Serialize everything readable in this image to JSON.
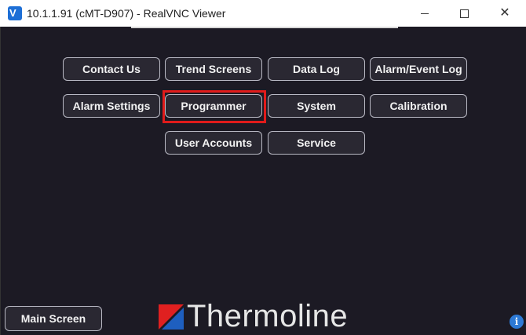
{
  "window": {
    "title": "10.1.1.91 (cMT-D907) - RealVNC Viewer",
    "minimize_glyph": "",
    "close_glyph": "✕"
  },
  "menu": {
    "row1": [
      "Contact Us",
      "Trend Screens",
      "Data Log",
      "Alarm/Event Log"
    ],
    "row2": [
      "Alarm Settings",
      "Programmer",
      "System",
      "Calibration"
    ],
    "row3": [
      "User Accounts",
      "Service"
    ]
  },
  "footer": {
    "main_screen": "Main Screen",
    "logo_text": "Thermoline",
    "info_glyph": "i"
  },
  "colors": {
    "background": "#1c1a24",
    "highlight": "#e01b1b",
    "logo_red": "#e02020",
    "logo_blue": "#1e5fbf"
  },
  "icons": [
    "realvnc-icon",
    "minimize-icon",
    "maximize-icon",
    "close-icon",
    "thermoline-logo-icon",
    "info-icon"
  ]
}
